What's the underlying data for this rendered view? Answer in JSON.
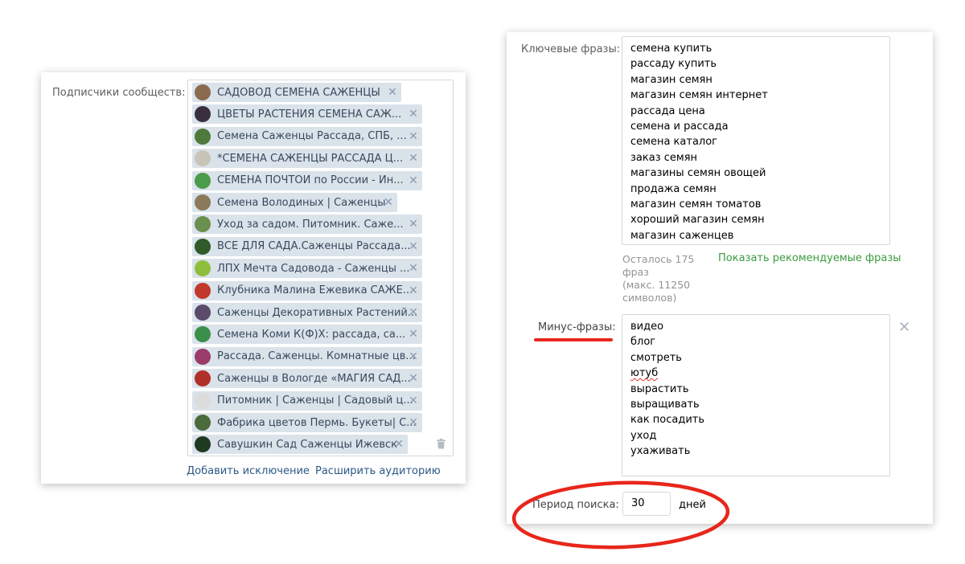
{
  "left": {
    "label": "Подписчики сообществ:",
    "tokens": [
      {
        "name": "САДОВОД СЕМЕНА САЖЕНЦЫ",
        "color": "#8a6b4e"
      },
      {
        "name": "ЦВЕТЫ РАСТЕНИЯ СЕМЕНА САЖ...",
        "color": "#3a2f3f"
      },
      {
        "name": "Семена Саженцы Рассада, СПБ, ...",
        "color": "#4f7a3d"
      },
      {
        "name": "*СЕМЕНА САЖЕНЦЫ РАССАДА Ц...",
        "color": "#c9c4b8"
      },
      {
        "name": "СЕМЕНА ПОЧТОЙ по России - Ин...",
        "color": "#4a9b4a"
      },
      {
        "name": "Семена Володиных | Саженцы",
        "color": "#8b7a5a"
      },
      {
        "name": "Уход за садом. Питомник. Саже...",
        "color": "#6b8f4e"
      },
      {
        "name": "ВСЁ ДЛЯ САДА.Саженцы Рассада...",
        "color": "#2f5a2a"
      },
      {
        "name": "ЛПХ Мечта Садовода - Саженцы ...",
        "color": "#8fbe3c"
      },
      {
        "name": "Клубника Малина Ежевика САЖЕ...",
        "color": "#c0392b"
      },
      {
        "name": "Саженцы Декоративных Растений...",
        "color": "#5a4b6b"
      },
      {
        "name": "Семена Коми К(Ф)Х: рассада, са...",
        "color": "#3a8f4a"
      },
      {
        "name": "Рассада. Саженцы. Комнатные цв...",
        "color": "#9b3b6b"
      },
      {
        "name": "Саженцы в Вологде «МАГИЯ САД...",
        "color": "#b0302a"
      },
      {
        "name": "Питомник | Саженцы | Садовый ц...",
        "color": "#dcdcdc"
      },
      {
        "name": "Фабрика цветов Пермь. Букеты| С...",
        "color": "#4a6b3a"
      },
      {
        "name": "Савушкин Сад Саженцы Ижевск",
        "color": "#1f3a1f"
      }
    ],
    "add_exclusion": "Добавить исключение",
    "expand_audience": "Расширить аудиторию"
  },
  "right": {
    "keywords_label": "Ключевые фразы:",
    "keywords": [
      "семена купить",
      "рассаду купить",
      "магазин семян",
      "магазин семян интернет",
      "рассада цена",
      "семена и рассада",
      "семена каталог",
      "заказ семян",
      "магазины семян овощей",
      "продажа семян",
      "магазин семян томатов",
      "хороший магазин семян",
      "магазин саженцев"
    ],
    "remaining_note": [
      "Осталось 175",
      "фраз",
      "(макс. 11250",
      "символов)"
    ],
    "show_recommended": "Показать рекомендуемые фразы",
    "minus_label": "Минус-фразы:",
    "minus": [
      "видео",
      "блог",
      "смотреть",
      "ютуб",
      "вырастить",
      "выращивать",
      "как посадить",
      "уход",
      "ухаживать"
    ],
    "period_label": "Период поиска:",
    "period_value": "30",
    "period_unit": "дней"
  }
}
